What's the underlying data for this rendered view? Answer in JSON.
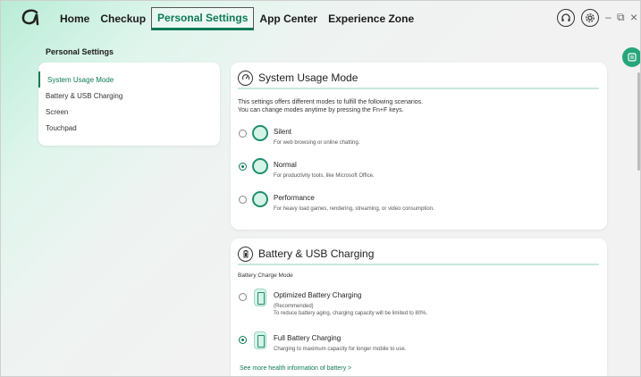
{
  "nav": {
    "items": [
      {
        "label": "Home"
      },
      {
        "label": "Checkup"
      },
      {
        "label": "Personal Settings"
      },
      {
        "label": "App Center"
      },
      {
        "label": "Experience Zone"
      }
    ],
    "active": "Personal Settings"
  },
  "window_controls": {
    "minimize": "–",
    "restore": "⧉",
    "close": "×"
  },
  "page_title": "Personal Settings",
  "sidebar": {
    "items": [
      {
        "label": "System Usage Mode"
      },
      {
        "label": "Battery & USB Charging"
      },
      {
        "label": "Screen"
      },
      {
        "label": "Touchpad"
      }
    ],
    "active": "System Usage Mode"
  },
  "usage_card": {
    "title": "System Usage Mode",
    "description_1": "This settings offers different modes to fulfill the following scenarios.",
    "description_2": "You can change modes anytime by pressing the Fn+F keys.",
    "options": [
      {
        "label": "Silent",
        "sub": "For web browsing or online chatting.",
        "selected": false
      },
      {
        "label": "Normal",
        "sub": "For productivity tools, like Microsoft Office.",
        "selected": true
      },
      {
        "label": "Performance",
        "sub": "For heavy load games, rendering, streaming, or video consumption.",
        "selected": false
      }
    ]
  },
  "battery_card": {
    "title": "Battery & USB Charging",
    "section_label": "Battery Charge Mode",
    "options": [
      {
        "label": "Optimized Battery Charging",
        "sub1": "(Recommended)",
        "sub2": "To reduce battery aging, charging capacity will be limited to 80%.",
        "selected": false
      },
      {
        "label": "Full Battery Charging",
        "sub1": "Charging to maximum capacity for longer mobile to use.",
        "selected": true
      }
    ],
    "link": "See more health information of battery >"
  },
  "colors": {
    "accent": "#0e7a57",
    "accent_light": "#d6f3e8"
  }
}
